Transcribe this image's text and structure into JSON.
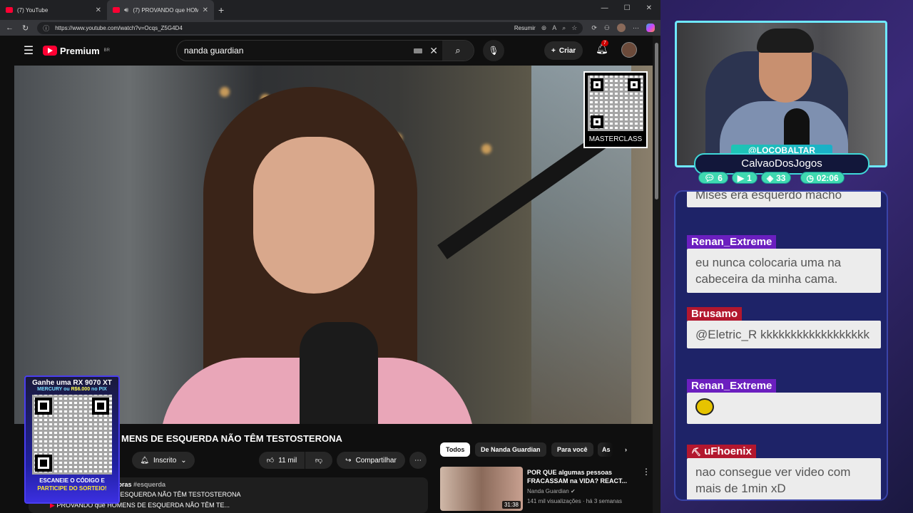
{
  "browser": {
    "tabs": [
      {
        "title": "(7) YouTube"
      },
      {
        "title": "(7) PROVANDO que HOMENS"
      }
    ],
    "url": "https://www.youtube.com/watch?v=Ocqs_Z5G4D4",
    "resumir": "Resumir"
  },
  "youtube": {
    "logo": "Premium",
    "region": "BR",
    "search_value": "nanda guardian",
    "create_label": "Criar",
    "notif_count": "7"
  },
  "video": {
    "qr_label": "MASTERCLASS",
    "title": "MENS DE ESQUERDA NÃO TÊM TESTOSTERONA",
    "subscribed_label": "Inscrito",
    "likes": "11 mil",
    "share_label": "Compartilhar",
    "desc_time": "horas",
    "desc_tag": "#esquerda",
    "desc_line2": "E ESQUERDA NÃO TÊM TESTOSTERONA",
    "desc_line3": "PROVANDO que HOMENS DE ESQUERDA NÃO TÊM TE..."
  },
  "chips": [
    "Todos",
    "De Nanda Guardian",
    "Para você",
    "As"
  ],
  "recommendation": {
    "title": "POR QUE algumas pessoas FRACASSAM na VIDA? REACT...",
    "channel": "Nanda Guardian",
    "stats": "141 mil visualizações · há 3 semanas",
    "duration": "31:38"
  },
  "promo": {
    "headline": "Ganhe uma RX 9070 XT",
    "sub_a": "MERCURY ou",
    "sub_b": "R$6.000",
    "sub_c": "no PIX",
    "footer1": "ESCANEIE O CÓDIGO E",
    "footer2": "PARTICIPE DO SORTEIO!"
  },
  "stream": {
    "handle": "@LOCOBALTAR",
    "name": "CalvaoDosJogos",
    "stats": [
      {
        "icon": "chat-icon",
        "value": "6"
      },
      {
        "icon": "youtube-icon",
        "value": "1"
      },
      {
        "icon": "kick-icon",
        "value": "33"
      }
    ],
    "timer": "02:06"
  },
  "chat": [
    {
      "user": "",
      "text": "Mises era esquerdo macho"
    },
    {
      "user": "Renan_Extreme",
      "text": "eu nunca colocaria uma na cabeceira da minha cama.",
      "color": "#6b1fbf"
    },
    {
      "user": "Brusamo",
      "text": "@Eletric_R kkkkkkkkkkkkkkkkkk",
      "color": "#b3172e"
    },
    {
      "user": "Renan_Extreme",
      "text": "",
      "color": "#6b1fbf"
    },
    {
      "user": "uFhoenix",
      "text": "nao consegue ver video com mais de 1min xD",
      "color": "#b3172e"
    }
  ]
}
